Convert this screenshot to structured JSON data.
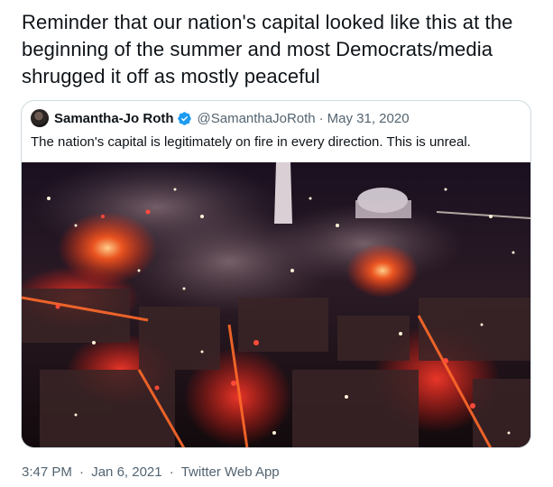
{
  "tweet": {
    "text": "Reminder that our nation's capital looked like this at the beginning of the summer and most Democrats/media shrugged it off as mostly peaceful",
    "time": "3:47 PM",
    "separator": "·",
    "date": "Jan 6, 2021",
    "source": "Twitter Web App"
  },
  "quoted_tweet": {
    "author_name": "Samantha-Jo Roth",
    "handle": "@SamanthaJoRoth",
    "separator": "·",
    "date": "May 31, 2020",
    "text": "The nation's capital is legitimately on fire in every direction. This is unreal.",
    "verified_icon": "verified-badge-icon",
    "verified_color": "#1d9bf0",
    "media": "aerial night photo of city with fires"
  },
  "colors": {
    "text_primary": "#0f1419",
    "text_secondary": "#536471",
    "border": "#cfd9de",
    "verified": "#1d9bf0"
  }
}
